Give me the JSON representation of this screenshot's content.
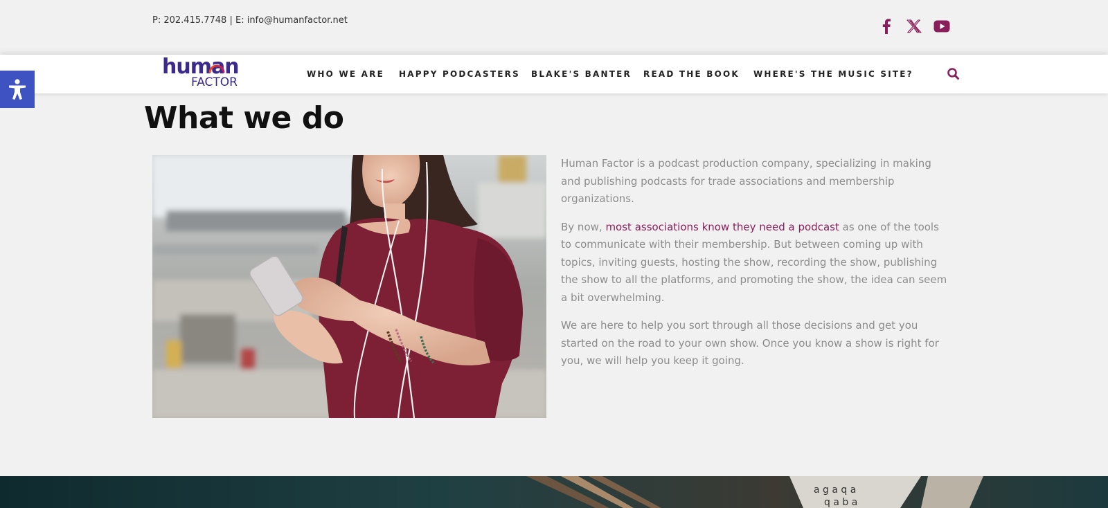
{
  "topbar": {
    "phone": "P: 202.415.7748",
    "separator": " | ",
    "email": "E: info@humanfactor.net",
    "social": [
      {
        "icon": "facebook-icon"
      },
      {
        "icon": "x-twitter-icon"
      },
      {
        "icon": "youtube-icon"
      }
    ]
  },
  "logo": {
    "word": "human",
    "sub": "FACTOR"
  },
  "nav": {
    "items": [
      {
        "label": "WHO WE ARE"
      },
      {
        "label": "HAPPY PODCASTERS"
      },
      {
        "label": "BLAKE'S BANTER"
      },
      {
        "label": "READ THE BOOK"
      },
      {
        "label": "WHERE'S THE MUSIC SITE?"
      }
    ],
    "search_icon": "search-icon"
  },
  "accessibility": {
    "icon": "accessibility-person-icon"
  },
  "main": {
    "heading": "What we do",
    "image_alt": "Woman in a maroon top using a smartphone with earphones",
    "para1": "Human Factor is a podcast production company, specializing in making and publishing podcasts for trade associations and membership organizations.",
    "para2_before": "By now, ",
    "para2_link": "most associations know they need a podcast",
    "para2_after": " as one of the tools to communicate with their membership. But between coming up with topics, inviting guests, hosting the show, recording the show, publishing the show to all the platforms, and promoting the show, the idea can seem a bit overwhelming.",
    "para3": "We are here to help you sort through all those decisions and get you started on the road to your own show. Once you know a show is right for you, we will help you keep it going."
  },
  "colors": {
    "brand_purple": "#3b2a8c",
    "accent_magenta": "#8a1e5a",
    "accessibility_blue": "#3e52c2",
    "body_text": "#8c8c8c",
    "page_bg": "#f1f1f1"
  }
}
